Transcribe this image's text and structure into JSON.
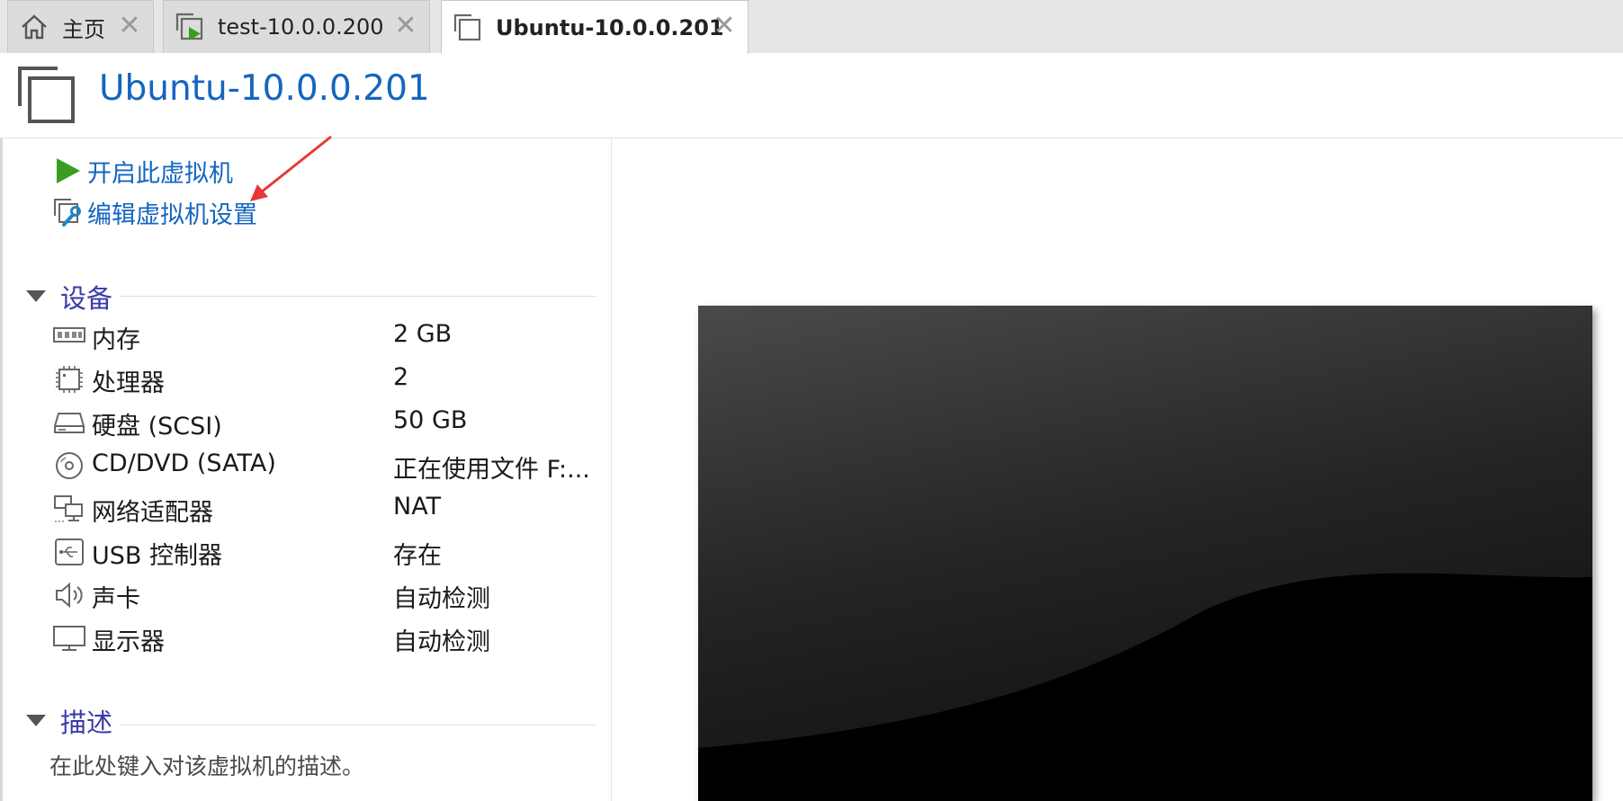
{
  "tabs": [
    {
      "label": "主页",
      "icon": "home-icon",
      "active": false
    },
    {
      "label": "test-10.0.0.200",
      "icon": "vm-running-icon",
      "active": false
    },
    {
      "label": "Ubuntu-10.0.0.201",
      "icon": "vm-icon",
      "active": true
    }
  ],
  "header": {
    "title": "Ubuntu-10.0.0.201",
    "icon": "vm-icon"
  },
  "actions": [
    {
      "label": "开启此虚拟机",
      "icon": "play-icon",
      "color": "#3a9d23"
    },
    {
      "label": "编辑虚拟机设置",
      "icon": "edit-settings-icon"
    }
  ],
  "devices": {
    "header": "设备",
    "items": [
      {
        "name": "内存",
        "value": "2 GB",
        "icon": "memory-icon"
      },
      {
        "name": "处理器",
        "value": "2",
        "icon": "processor-icon"
      },
      {
        "name": "硬盘 (SCSI)",
        "value": "50 GB",
        "icon": "hard-disk-icon"
      },
      {
        "name": "CD/DVD (SATA)",
        "value": "正在使用文件 F:...",
        "icon": "cd-dvd-icon"
      },
      {
        "name": "网络适配器",
        "value": "NAT",
        "icon": "network-adapter-icon"
      },
      {
        "name": "USB 控制器",
        "value": "存在",
        "icon": "usb-icon"
      },
      {
        "name": "声卡",
        "value": "自动检测",
        "icon": "sound-icon"
      },
      {
        "name": "显示器",
        "value": "自动检测",
        "icon": "display-icon"
      }
    ]
  },
  "description": {
    "header": "描述",
    "placeholder": "在此处键入对该虚拟机的描述。"
  },
  "colors": {
    "accent": "#1565c0",
    "section": "#3a3aa8",
    "play": "#3a9d23",
    "annotation_arrow": "#e53935"
  }
}
